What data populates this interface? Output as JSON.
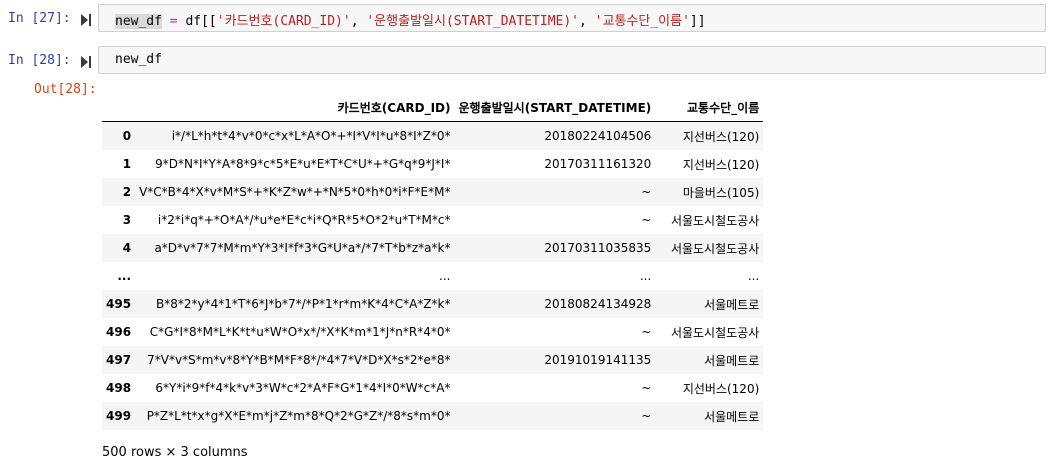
{
  "cells": [
    {
      "prompt": "In [27]:",
      "code_parts": [
        "new_df",
        " ",
        "=",
        " df[[",
        "'카드번호(CARD_ID)'",
        ", ",
        "'운행출발일시(START_DATETIME)'",
        ", ",
        "'교통수단_이름'",
        "]]"
      ]
    },
    {
      "prompt": "In [28]:",
      "code": "new_df"
    }
  ],
  "output": {
    "prompt": "Out[28]:",
    "columns": [
      "카드번호(CARD_ID)",
      "운행출발일시(START_DATETIME)",
      "교통수단_이름"
    ],
    "rows": [
      {
        "index": "0",
        "card_id": "i*/*L*h*t*4*v*0*c*x*L*A*O*+*I*V*I*u*8*I*Z*0*",
        "start": "20180224104506",
        "transport": "지선버스(120)"
      },
      {
        "index": "1",
        "card_id": "9*D*N*I*Y*A*8*9*c*5*E*u*E*T*C*U*+*G*q*9*J*I*",
        "start": "20170311161320",
        "transport": "지선버스(120)"
      },
      {
        "index": "2",
        "card_id": "V*C*B*4*X*v*M*S*+*K*Z*w*+*N*5*0*h*0*i*F*E*M*",
        "start": "~",
        "transport": "마을버스(105)"
      },
      {
        "index": "3",
        "card_id": "i*2*i*q*+*O*A*/*u*e*E*c*i*Q*R*5*O*2*u*T*M*c*",
        "start": "~",
        "transport": "서울도시철도공사"
      },
      {
        "index": "4",
        "card_id": "a*D*v*7*7*M*m*Y*3*I*f*3*G*U*a*/*7*T*b*z*a*k*",
        "start": "20170311035835",
        "transport": "서울도시철도공사"
      },
      {
        "index": "...",
        "card_id": "...",
        "start": "...",
        "transport": "..."
      },
      {
        "index": "495",
        "card_id": "B*8*2*y*4*1*T*6*J*b*7*/*P*1*r*m*K*4*C*A*Z*k*",
        "start": "20180824134928",
        "transport": "서울메트로"
      },
      {
        "index": "496",
        "card_id": "C*G*I*8*M*L*K*t*u*W*O*x*/*X*K*m*1*J*n*R*4*0*",
        "start": "~",
        "transport": "서울도시철도공사"
      },
      {
        "index": "497",
        "card_id": "7*V*v*S*m*v*8*Y*B*M*F*8*/*4*7*V*D*X*s*2*e*8*",
        "start": "20191019141135",
        "transport": "서울메트로"
      },
      {
        "index": "498",
        "card_id": "6*Y*i*9*f*4*k*v*3*W*c*2*A*F*G*1*4*I*0*W*c*A*",
        "start": "~",
        "transport": "지선버스(120)"
      },
      {
        "index": "499",
        "card_id": "P*Z*L*t*x*g*X*E*m*j*Z*m*8*Q*2*G*Z*/*8*s*m*0*",
        "start": "~",
        "transport": "서울메트로"
      }
    ],
    "summary": "500 rows × 3 columns"
  },
  "icons": {
    "run_cell": "run-cell-icon"
  }
}
